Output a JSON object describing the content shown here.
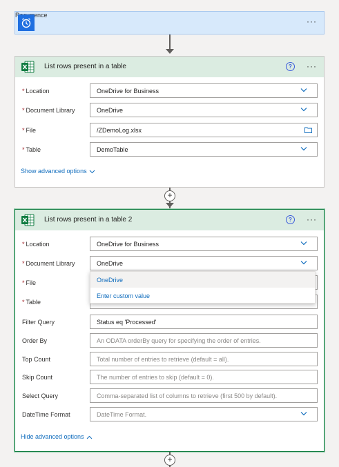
{
  "trigger": {
    "title": "Recurrence",
    "more": "···"
  },
  "action1": {
    "title": "List rows present in a table",
    "help": "?",
    "more": "···",
    "fields": {
      "location": {
        "label": "Location",
        "value": "OneDrive for Business"
      },
      "library": {
        "label": "Document Library",
        "value": "OneDrive"
      },
      "file": {
        "label": "File",
        "value": "/ZDemoLog.xlsx"
      },
      "table": {
        "label": "Table",
        "value": "DemoTable"
      }
    },
    "advanced_link": "Show advanced options"
  },
  "action2": {
    "title": "List rows present in a table 2",
    "help": "?",
    "more": "···",
    "fields": {
      "location": {
        "label": "Location",
        "value": "OneDrive for Business"
      },
      "library": {
        "label": "Document Library",
        "value": "OneDrive"
      },
      "file": {
        "label": "File",
        "value": ""
      },
      "table": {
        "label": "Table",
        "value": ""
      },
      "filter": {
        "label": "Filter Query",
        "value": "Status eq 'Processed'"
      },
      "orderby": {
        "label": "Order By",
        "placeholder": "An ODATA orderBy query for specifying the order of entries."
      },
      "top": {
        "label": "Top Count",
        "placeholder": "Total number of entries to retrieve (default = all)."
      },
      "skip": {
        "label": "Skip Count",
        "placeholder": "The number of entries to skip (default = 0)."
      },
      "select": {
        "label": "Select Query",
        "placeholder": "Comma-separated list of columns to retrieve (first 500 by default)."
      },
      "datetime": {
        "label": "DateTime Format",
        "placeholder": "DateTime Format."
      }
    },
    "advanced_link": "Hide advanced options"
  },
  "dropdown": {
    "options": [
      "OneDrive",
      "Enter custom value"
    ]
  },
  "required_mark": "*",
  "plus": "+",
  "colors": {
    "accent": "#0f6cbd",
    "excel_green": "#107c41",
    "trigger_blue": "#1f6fe0"
  }
}
